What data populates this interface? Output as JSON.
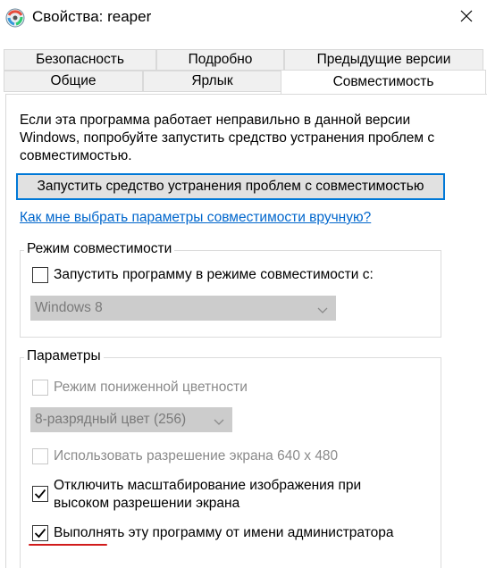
{
  "window": {
    "title": "Свойства: reaper",
    "icon": "reaper-app-icon",
    "close_icon": "close-icon"
  },
  "tabs_row1": [
    {
      "label": "Безопасность",
      "active": false
    },
    {
      "label": "Подробно",
      "active": false
    },
    {
      "label": "Предыдущие версии",
      "active": false
    }
  ],
  "tabs_row2": [
    {
      "label": "Общие",
      "active": false
    },
    {
      "label": "Ярлык",
      "active": false
    },
    {
      "label": "Совместимость",
      "active": true
    }
  ],
  "compat": {
    "description": "Если эта программа работает неправильно в данной версии Windows, попробуйте запустить средство устранения проблем с совместимостью.",
    "troubleshoot_button": "Запустить средство устранения проблем с совместимостью",
    "help_link": "Как мне выбрать параметры совместимости вручную?",
    "mode_group": {
      "title": "Режим совместимости",
      "checkbox_label": "Запустить программу в режиме совместимости с:",
      "checked": false,
      "os_select_value": "Windows 8"
    },
    "params_group": {
      "title": "Параметры",
      "reduced_color": {
        "label": "Режим пониженной цветности",
        "checked": false,
        "enabled": false
      },
      "color_select_value": "8-разрядный цвет (256)",
      "res_640": {
        "label": "Использовать разрешение экрана 640 x 480",
        "checked": false,
        "enabled": false
      },
      "disable_scaling": {
        "label_line1": "Отключить масштабирование изображения при",
        "label_line2": "высоком разрешении экрана",
        "checked": true,
        "enabled": true
      },
      "run_as_admin": {
        "label": "Выполнять эту программу от имени администратора",
        "checked": true,
        "enabled": true
      }
    }
  },
  "colors": {
    "accent": "#0078d7",
    "link": "#0066cc",
    "annotation_red": "#d11b1b"
  }
}
